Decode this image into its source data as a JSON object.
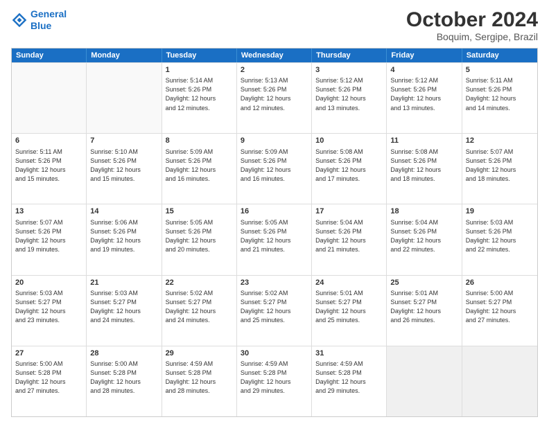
{
  "logo": {
    "line1": "General",
    "line2": "Blue"
  },
  "title": "October 2024",
  "subtitle": "Boquim, Sergipe, Brazil",
  "header": {
    "days": [
      "Sunday",
      "Monday",
      "Tuesday",
      "Wednesday",
      "Thursday",
      "Friday",
      "Saturday"
    ]
  },
  "weeks": [
    [
      {
        "day": "",
        "empty": true
      },
      {
        "day": "",
        "empty": true
      },
      {
        "day": "1",
        "sunrise": "5:14 AM",
        "sunset": "5:26 PM",
        "daylight": "12 hours and 12 minutes."
      },
      {
        "day": "2",
        "sunrise": "5:13 AM",
        "sunset": "5:26 PM",
        "daylight": "12 hours and 12 minutes."
      },
      {
        "day": "3",
        "sunrise": "5:12 AM",
        "sunset": "5:26 PM",
        "daylight": "12 hours and 13 minutes."
      },
      {
        "day": "4",
        "sunrise": "5:12 AM",
        "sunset": "5:26 PM",
        "daylight": "12 hours and 13 minutes."
      },
      {
        "day": "5",
        "sunrise": "5:11 AM",
        "sunset": "5:26 PM",
        "daylight": "12 hours and 14 minutes."
      }
    ],
    [
      {
        "day": "6",
        "sunrise": "5:11 AM",
        "sunset": "5:26 PM",
        "daylight": "12 hours and 15 minutes."
      },
      {
        "day": "7",
        "sunrise": "5:10 AM",
        "sunset": "5:26 PM",
        "daylight": "12 hours and 15 minutes."
      },
      {
        "day": "8",
        "sunrise": "5:09 AM",
        "sunset": "5:26 PM",
        "daylight": "12 hours and 16 minutes."
      },
      {
        "day": "9",
        "sunrise": "5:09 AM",
        "sunset": "5:26 PM",
        "daylight": "12 hours and 16 minutes."
      },
      {
        "day": "10",
        "sunrise": "5:08 AM",
        "sunset": "5:26 PM",
        "daylight": "12 hours and 17 minutes."
      },
      {
        "day": "11",
        "sunrise": "5:08 AM",
        "sunset": "5:26 PM",
        "daylight": "12 hours and 18 minutes."
      },
      {
        "day": "12",
        "sunrise": "5:07 AM",
        "sunset": "5:26 PM",
        "daylight": "12 hours and 18 minutes."
      }
    ],
    [
      {
        "day": "13",
        "sunrise": "5:07 AM",
        "sunset": "5:26 PM",
        "daylight": "12 hours and 19 minutes."
      },
      {
        "day": "14",
        "sunrise": "5:06 AM",
        "sunset": "5:26 PM",
        "daylight": "12 hours and 19 minutes."
      },
      {
        "day": "15",
        "sunrise": "5:05 AM",
        "sunset": "5:26 PM",
        "daylight": "12 hours and 20 minutes."
      },
      {
        "day": "16",
        "sunrise": "5:05 AM",
        "sunset": "5:26 PM",
        "daylight": "12 hours and 21 minutes."
      },
      {
        "day": "17",
        "sunrise": "5:04 AM",
        "sunset": "5:26 PM",
        "daylight": "12 hours and 21 minutes."
      },
      {
        "day": "18",
        "sunrise": "5:04 AM",
        "sunset": "5:26 PM",
        "daylight": "12 hours and 22 minutes."
      },
      {
        "day": "19",
        "sunrise": "5:03 AM",
        "sunset": "5:26 PM",
        "daylight": "12 hours and 22 minutes."
      }
    ],
    [
      {
        "day": "20",
        "sunrise": "5:03 AM",
        "sunset": "5:27 PM",
        "daylight": "12 hours and 23 minutes."
      },
      {
        "day": "21",
        "sunrise": "5:03 AM",
        "sunset": "5:27 PM",
        "daylight": "12 hours and 24 minutes."
      },
      {
        "day": "22",
        "sunrise": "5:02 AM",
        "sunset": "5:27 PM",
        "daylight": "12 hours and 24 minutes."
      },
      {
        "day": "23",
        "sunrise": "5:02 AM",
        "sunset": "5:27 PM",
        "daylight": "12 hours and 25 minutes."
      },
      {
        "day": "24",
        "sunrise": "5:01 AM",
        "sunset": "5:27 PM",
        "daylight": "12 hours and 25 minutes."
      },
      {
        "day": "25",
        "sunrise": "5:01 AM",
        "sunset": "5:27 PM",
        "daylight": "12 hours and 26 minutes."
      },
      {
        "day": "26",
        "sunrise": "5:00 AM",
        "sunset": "5:27 PM",
        "daylight": "12 hours and 27 minutes."
      }
    ],
    [
      {
        "day": "27",
        "sunrise": "5:00 AM",
        "sunset": "5:28 PM",
        "daylight": "12 hours and 27 minutes."
      },
      {
        "day": "28",
        "sunrise": "5:00 AM",
        "sunset": "5:28 PM",
        "daylight": "12 hours and 28 minutes."
      },
      {
        "day": "29",
        "sunrise": "4:59 AM",
        "sunset": "5:28 PM",
        "daylight": "12 hours and 28 minutes."
      },
      {
        "day": "30",
        "sunrise": "4:59 AM",
        "sunset": "5:28 PM",
        "daylight": "12 hours and 29 minutes."
      },
      {
        "day": "31",
        "sunrise": "4:59 AM",
        "sunset": "5:28 PM",
        "daylight": "12 hours and 29 minutes."
      },
      {
        "day": "",
        "empty": true
      },
      {
        "day": "",
        "empty": true
      }
    ]
  ],
  "labels": {
    "sunrise": "Sunrise:",
    "sunset": "Sunset:",
    "daylight": "Daylight: "
  }
}
